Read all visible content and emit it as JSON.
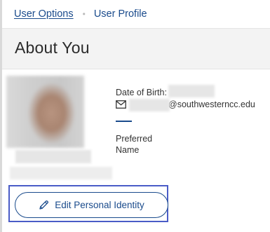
{
  "breadcrumb": {
    "parent_label": "User Options",
    "separator": "•",
    "current_label": "User Profile"
  },
  "page": {
    "title": "About You"
  },
  "profile": {
    "date_of_birth_label": "Date of Birth:",
    "email_domain": "@southwesterncc.edu",
    "preferred_name_label": "Preferred Name"
  },
  "actions": {
    "edit_personal_identity_label": "Edit Personal Identity"
  },
  "colors": {
    "link": "#1a4b8c",
    "focus_ring": "#4a5cc7",
    "title_band": "#f3f3f3"
  },
  "icons": {
    "email": "envelope-icon",
    "edit": "pencil-icon"
  }
}
